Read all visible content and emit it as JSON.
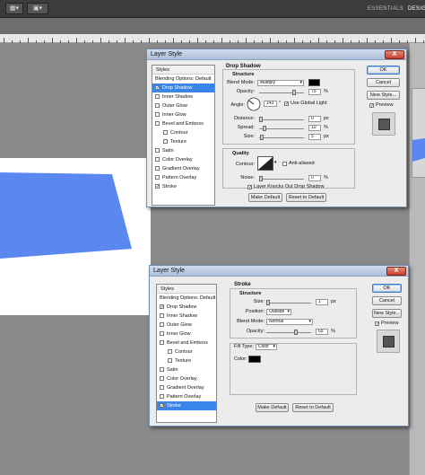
{
  "app": {
    "workspace_label": "ESSENTIALS",
    "design_label": "DESIG"
  },
  "dialog1": {
    "title": "Layer Style",
    "close": "X",
    "styles_header": "Styles",
    "items": [
      {
        "label": "Blending Options: Default",
        "checkbox": false
      },
      {
        "label": "Drop Shadow",
        "checkbox": true,
        "checked": true,
        "selected": true
      },
      {
        "label": "Inner Shadow",
        "checkbox": true
      },
      {
        "label": "Outer Glow",
        "checkbox": true
      },
      {
        "label": "Inner Glow",
        "checkbox": true
      },
      {
        "label": "Bevel and Emboss",
        "checkbox": true
      },
      {
        "label": "Contour",
        "checkbox": true,
        "indent": true
      },
      {
        "label": "Texture",
        "checkbox": true,
        "indent": true
      },
      {
        "label": "Satin",
        "checkbox": true
      },
      {
        "label": "Color Overlay",
        "checkbox": true
      },
      {
        "label": "Gradient Overlay",
        "checkbox": true
      },
      {
        "label": "Pattern Overlay",
        "checkbox": true
      },
      {
        "label": "Stroke",
        "checkbox": true,
        "checked": true
      }
    ],
    "section_title": "Drop Shadow",
    "structure_label": "Structure",
    "blend_mode_label": "Blend Mode:",
    "blend_mode_value": "Multiply",
    "opacity_label": "Opacity:",
    "opacity_value": "75",
    "angle_label": "Angle:",
    "angle_value": "143",
    "use_global_light": "Use Global Light",
    "distance_label": "Distance:",
    "distance_value": "0",
    "spread_label": "Spread:",
    "spread_value": "10",
    "size_label": "Size:",
    "size_value": "5",
    "quality_label": "Quality",
    "contour_label": "Contour:",
    "anti_aliased": "Anti-aliased",
    "noise_label": "Noise:",
    "noise_value": "0",
    "knockout_label": "Layer Knocks Out Drop Shadow",
    "make_default": "Make Default",
    "reset_default": "Reset to Default",
    "ok": "OK",
    "cancel": "Cancel",
    "new_style": "New Style...",
    "preview": "Preview",
    "percent": "%",
    "degree": "°",
    "px": "px"
  },
  "dialog2": {
    "title": "Layer Style",
    "close": "X",
    "styles_header": "Styles",
    "items": [
      {
        "label": "Blending Options: Default",
        "checkbox": false
      },
      {
        "label": "Drop Shadow",
        "checkbox": true,
        "checked": true
      },
      {
        "label": "Inner Shadow",
        "checkbox": true
      },
      {
        "label": "Outer Glow",
        "checkbox": true
      },
      {
        "label": "Inner Glow",
        "checkbox": true
      },
      {
        "label": "Bevel and Emboss",
        "checkbox": true
      },
      {
        "label": "Contour",
        "checkbox": true,
        "indent": true
      },
      {
        "label": "Texture",
        "checkbox": true,
        "indent": true
      },
      {
        "label": "Satin",
        "checkbox": true
      },
      {
        "label": "Color Overlay",
        "checkbox": true
      },
      {
        "label": "Gradient Overlay",
        "checkbox": true
      },
      {
        "label": "Pattern Overlay",
        "checkbox": true
      },
      {
        "label": "Stroke",
        "checkbox": true,
        "checked": true,
        "selected": true
      }
    ],
    "section_title": "Stroke",
    "structure_label": "Structure",
    "size_label": "Size:",
    "size_value": "1",
    "position_label": "Position:",
    "position_value": "Outside",
    "blend_mode_label": "Blend Mode:",
    "blend_mode_value": "Normal",
    "opacity_label": "Opacity:",
    "opacity_value": "65",
    "fill_type_label": "Fill Type:",
    "fill_type_value": "Color",
    "color_label": "Color:",
    "make_default": "Make Default",
    "reset_default": "Reset to Default",
    "ok": "OK",
    "cancel": "Cancel",
    "new_style": "New Style...",
    "preview": "Preview",
    "percent": "%",
    "px": "px"
  },
  "colors": {
    "shape_blue": "#5b87f0",
    "selection_blue": "#3a86e8",
    "swatch_black": "#000000"
  }
}
